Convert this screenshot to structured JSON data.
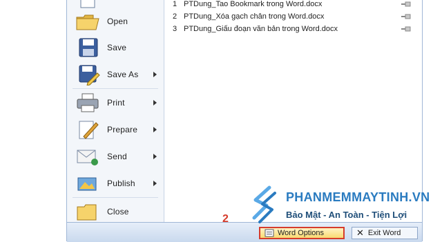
{
  "menu": {
    "items": [
      {
        "label": "Open",
        "icon": "open-folder-icon",
        "has_arrow": false
      },
      {
        "label": "Save",
        "icon": "save-disk-icon",
        "has_arrow": false
      },
      {
        "label": "Save As",
        "icon": "save-as-icon",
        "has_arrow": true
      },
      {
        "label": "Print",
        "icon": "printer-icon",
        "has_arrow": true
      },
      {
        "label": "Prepare",
        "icon": "prepare-icon",
        "has_arrow": true
      },
      {
        "label": "Send",
        "icon": "send-icon",
        "has_arrow": true
      },
      {
        "label": "Publish",
        "icon": "publish-icon",
        "has_arrow": true
      },
      {
        "label": "Close",
        "icon": "close-folder-icon",
        "has_arrow": false
      }
    ]
  },
  "recent_documents": [
    {
      "num": "1",
      "name": "PTDung_Tao Bookmark trong Word.docx"
    },
    {
      "num": "2",
      "name": "PTDung_Xóa gạch chân trong Word.docx"
    },
    {
      "num": "3",
      "name": "PTDung_Giấu đoạn văn bản trong Word.docx"
    }
  ],
  "bottom": {
    "options_label": "Word Options",
    "exit_label": "Exit Word",
    "step_marker": "2"
  },
  "watermark": {
    "line1": "PHANMEMMAYTINH.VN",
    "line2": "Bảo Mật - An Toàn - Tiện Lợi"
  },
  "colors": {
    "highlight_border": "#d63b2a",
    "watermark_blue": "#2a7bc0"
  }
}
